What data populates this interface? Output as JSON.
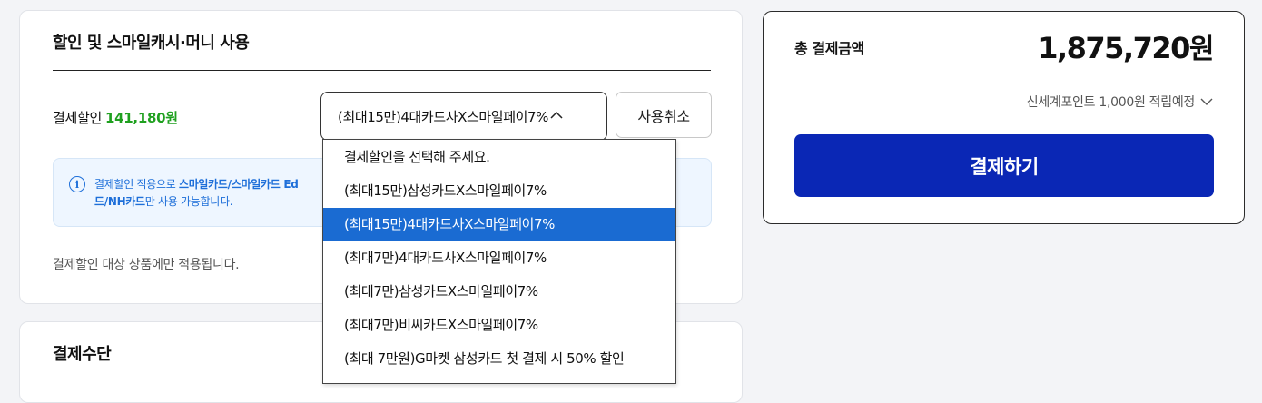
{
  "discount_section": {
    "title": "할인 및 스마일캐시·머니 사용",
    "discount_label": "결제할인",
    "discount_amount": "141,180원",
    "selected_option": "(최대15만)4대카드사X스마일페이7%",
    "cancel_label": "사용취소",
    "notice_prefix": "결제할인 적용으로 ",
    "notice_bold_1": "스마일카드/스마일카드 Ed",
    "notice_bold_2": "드/NH카드",
    "notice_suffix": "만 사용 가능합니다.",
    "footnote": "결제할인 대상 상품에만 적용됩니다.",
    "dropdown_options": [
      "결제할인을 선택해 주세요.",
      "(최대15만)삼성카드X스마일페이7%",
      "(최대15만)4대카드사X스마일페이7%",
      "(최대7만)4대카드사X스마일페이7%",
      "(최대7만)삼성카드X스마일페이7%",
      "(최대7만)비씨카드X스마일페이7%",
      "(최대 7만원)G마켓 삼성카드 첫 결제 시 50% 할인"
    ],
    "selected_index": 2
  },
  "payment_method": {
    "title": "결제수단"
  },
  "summary": {
    "total_label": "총 결제금액",
    "total_value": "1,875,720",
    "total_unit": "원",
    "points_text": "신세계포인트 1,000원 적립예정",
    "pay_button": "결제하기"
  },
  "colors": {
    "discount_green": "#1fa01f",
    "notice_blue": "#1e6fd9",
    "pay_button_bg": "#0a27b5",
    "selected_option_bg": "#1a6bd2"
  }
}
